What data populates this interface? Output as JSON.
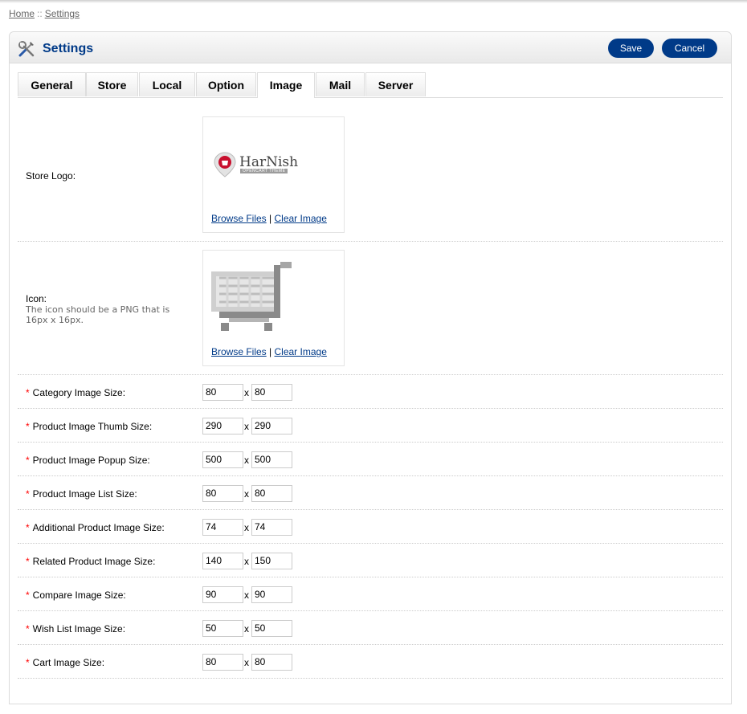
{
  "breadcrumb": {
    "home": "Home",
    "separator": "::",
    "settings": "Settings"
  },
  "heading": {
    "title": "Settings",
    "icon": "wrench-screwdriver-icon"
  },
  "buttons": {
    "save": "Save",
    "cancel": "Cancel"
  },
  "colors": {
    "brand": "#003a88",
    "required": "#ff0000",
    "logo_red": "#c8102e"
  },
  "tabs": [
    "General",
    "Store",
    "Local",
    "Option",
    "Image",
    "Mail",
    "Server"
  ],
  "active_tab": "Image",
  "store_logo": {
    "label": "Store Logo:",
    "logo_text": "HarNish",
    "logo_subtext": "OPENCART THEME",
    "browse": "Browse Files",
    "divider": "|",
    "clear": "Clear Image"
  },
  "icon": {
    "label": "Icon:",
    "help": "The icon should be a PNG that is 16px x 16px.",
    "browse": "Browse Files",
    "divider": "|",
    "clear": "Clear Image"
  },
  "required_mark": "*",
  "size_separator": "x",
  "sizes": [
    {
      "label": "Category Image Size:",
      "width": "80",
      "height": "80"
    },
    {
      "label": "Product Image Thumb Size:",
      "width": "290",
      "height": "290"
    },
    {
      "label": "Product Image Popup Size:",
      "width": "500",
      "height": "500"
    },
    {
      "label": "Product Image List Size:",
      "width": "80",
      "height": "80"
    },
    {
      "label": "Additional Product Image Size:",
      "width": "74",
      "height": "74"
    },
    {
      "label": "Related Product Image Size:",
      "width": "140",
      "height": "150"
    },
    {
      "label": "Compare Image Size:",
      "width": "90",
      "height": "90"
    },
    {
      "label": "Wish List Image Size:",
      "width": "50",
      "height": "50"
    },
    {
      "label": "Cart Image Size:",
      "width": "80",
      "height": "80"
    }
  ]
}
